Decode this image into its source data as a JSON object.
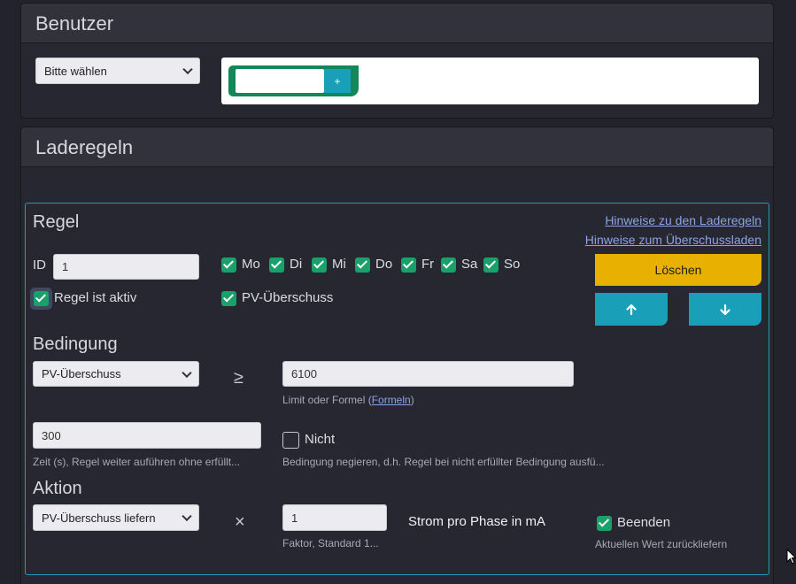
{
  "benutzer": {
    "title": "Benutzer",
    "select_value": "Bitte wählen",
    "add_label": "+"
  },
  "laderegeln": {
    "title": "Laderegeln",
    "regel": {
      "title": "Regel",
      "link_hinweise_laderegeln": "Hinweise zu den Laderegeln",
      "link_hinweise_ueberschuss": "Hinweise zum Überschussladen",
      "id_label": "ID",
      "id_value": "1",
      "days": [
        "Mo",
        "Di",
        "Mi",
        "Do",
        "Fr",
        "Sa",
        "So"
      ],
      "aktiv_label": "Regel ist aktiv",
      "pv_label": "PV-Überschuss",
      "delete_label": "Löschen"
    },
    "bedingung": {
      "title": "Bedingung",
      "select_value": "PV-Überschuss",
      "operator": "≥",
      "limit_value": "6100",
      "limit_help_prefix": "Limit oder Formel (",
      "limit_help_link": "Formeln",
      "limit_help_suffix": ")",
      "zeit_value": "300",
      "zeit_help": "Zeit (s), Regel weiter auführen ohne erfüllt...",
      "nicht_label": "Nicht",
      "nicht_help": "Bedingung negieren, d.h. Regel bei nicht erfüllter Bedingung ausfü..."
    },
    "aktion": {
      "title": "Aktion",
      "select_value": "PV-Überschuss liefern",
      "operator": "×",
      "faktor_value": "1",
      "faktor_help": "Faktor, Standard 1...",
      "strom_label": "Strom pro Phase in mA",
      "beenden_label": "Beenden",
      "beenden_help": "Aktuellen Wert zurückliefern"
    }
  },
  "colors": {
    "accent_green": "#1aa06a",
    "accent_teal": "#1a9fb8",
    "delete_yellow": "#e8b000",
    "link": "#8aa3e8"
  }
}
